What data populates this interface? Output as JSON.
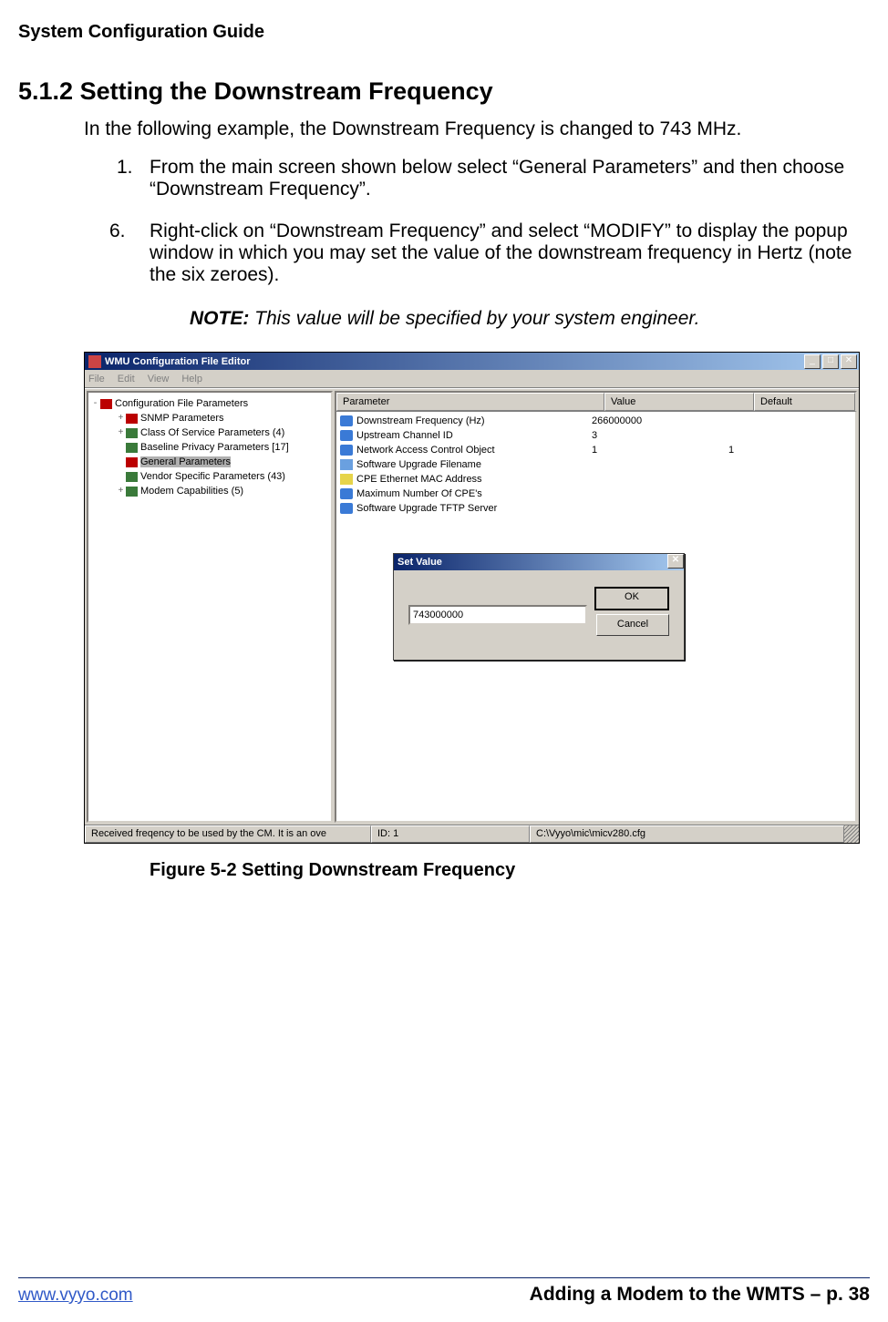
{
  "doc": {
    "header": "System Configuration Guide",
    "section_number": "5.1.2",
    "section_title": "Setting the Downstream Frequency",
    "intro": "In the following example, the Downstream Frequency is changed to 743 MHz.",
    "step1_num": "1.",
    "step1_text": "From the main screen shown below select “General Parameters” and then choose “Downstream Frequency”.",
    "step6_num": "6.",
    "step6_text": "Right-click on “Downstream Frequency” and select “MODIFY” to display the popup window in which you may set the value of the downstream frequency in Hertz (note the six zeroes).",
    "note_label": "NOTE:",
    "note_body": "This value will be specified by your system engineer.",
    "figure_caption": "Figure 5-2 Setting Downstream Frequency",
    "footer_link": "www.vyyo.com",
    "footer_right": "Adding a Modem to the WMTS – p. 38"
  },
  "app": {
    "title": "WMU Configuration File Editor",
    "menus": [
      "File",
      "Edit",
      "View",
      "Help"
    ],
    "winbtns": {
      "min": "_",
      "max": "□",
      "close": "✕"
    },
    "tree": {
      "root": "Configuration File Parameters",
      "items": [
        {
          "label": "SNMP Parameters",
          "type": "red",
          "exp": "+"
        },
        {
          "label": "Class Of Service Parameters (4)",
          "type": "green",
          "exp": "+"
        },
        {
          "label": "Baseline Privacy Parameters [17]",
          "type": "green",
          "exp": ""
        },
        {
          "label": "General Parameters",
          "type": "red",
          "exp": "",
          "selected": true
        },
        {
          "label": "Vendor Specific Parameters (43)",
          "type": "green",
          "exp": ""
        },
        {
          "label": "Modem Capabilities (5)",
          "type": "green",
          "exp": "+"
        }
      ]
    },
    "list": {
      "columns": [
        "Parameter",
        "Value",
        "Default"
      ],
      "rows": [
        {
          "icon": "b",
          "name": "Downstream Frequency  (Hz)",
          "value": "266000000",
          "def": ""
        },
        {
          "icon": "b",
          "name": "Upstream Channel ID",
          "value": "3",
          "def": ""
        },
        {
          "icon": "b",
          "name": "Network Access Control Object",
          "value": "1",
          "def": "1"
        },
        {
          "icon": "p",
          "name": "Software Upgrade Filename",
          "value": "",
          "def": ""
        },
        {
          "icon": "y",
          "name": "CPE Ethernet MAC Address",
          "value": "",
          "def": ""
        },
        {
          "icon": "b",
          "name": "Maximum Number Of CPE's",
          "value": "",
          "def": ""
        },
        {
          "icon": "b",
          "name": "Software Upgrade TFTP Server",
          "value": "",
          "def": ""
        }
      ]
    },
    "statusbar": {
      "s1": "Received freqency to be used by the CM.  It is an ove",
      "s2": "ID: 1",
      "s3": "C:\\Vyyo\\mic\\micv280.cfg"
    }
  },
  "dialog": {
    "title": "Set Value",
    "input_value": "743000000",
    "ok": "OK",
    "cancel": "Cancel",
    "close": "✕"
  }
}
